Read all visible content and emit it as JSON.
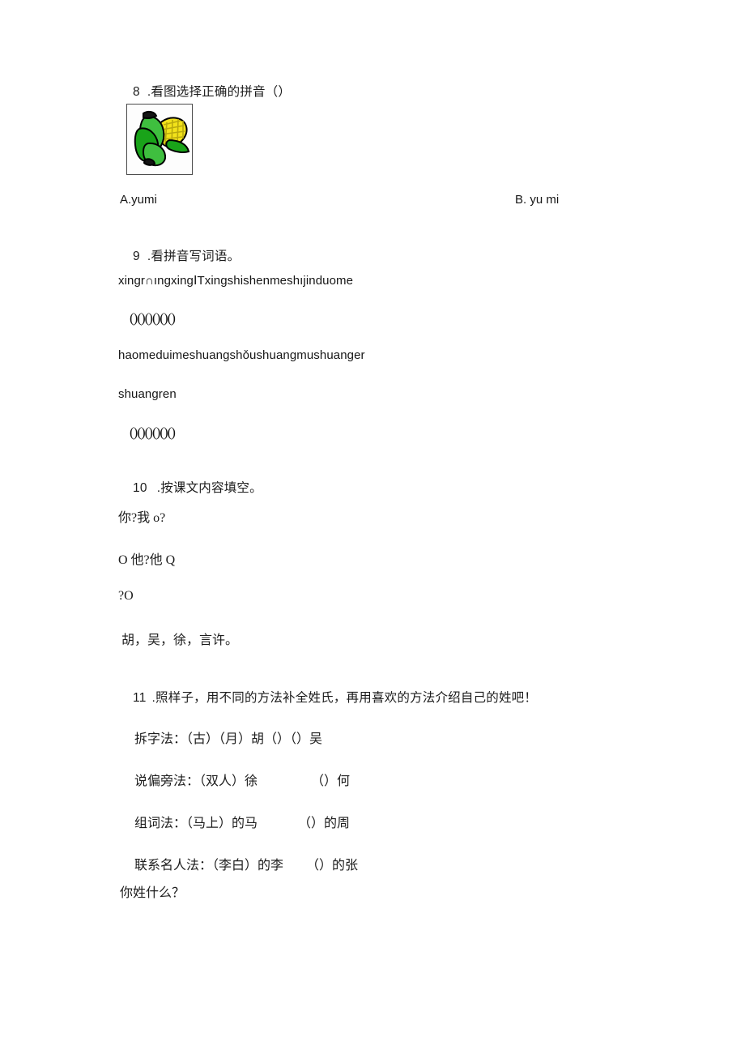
{
  "document": {
    "type": "chinese-primary-worksheet",
    "page_background": "#ffffff",
    "text_color": "#1c1c1c"
  },
  "questions": [
    {
      "id": "q8",
      "number": "8",
      "separator": ".",
      "prompt": "看图选择正确的拼音（）",
      "image": {
        "name": "corn-illustration",
        "alt": "玉米",
        "colors": {
          "husk_light": "#3fbf3f",
          "husk_mid": "#19a319",
          "husk_dark": "#0d7a0d",
          "kernel": "#f2e21a",
          "kernel_shade": "#c9bb12",
          "outline": "#000000",
          "frame": "#4a4a4a"
        }
      },
      "options": [
        {
          "label": "A.yumi"
        },
        {
          "label": "B. yu mi"
        }
      ]
    },
    {
      "id": "q9",
      "number": "9",
      "separator": ".",
      "prompt": "看拼音写词语。",
      "pinyin_lines": [
        "xingr∩ıngxingⅠTxingshishenmeshıjinduome",
        "haomeduimeshuangshǒushuangmushuanger",
        "shuangren"
      ],
      "answer_rows": [
        "()()()()()()",
        "()()()()()()"
      ]
    },
    {
      "id": "q10",
      "number": "10",
      "separator": ".",
      "prompt": "按课文内容填空。",
      "lines": [
        "你?我 o?",
        "O 他?他 Q",
        "?O",
        "胡，吴，徐，言许。"
      ]
    },
    {
      "id": "q11",
      "number": "11",
      "separator": ".",
      "prompt": "照样子，用不同的方法补全姓氏，再用喜欢的方法介绍自己的姓吧！",
      "methods": [
        {
          "name": "拆字法：",
          "example": "（古）（月）胡",
          "blank": "（）（）吴"
        },
        {
          "name": "说偏旁法：",
          "example": "（双人）徐",
          "blank": "（）何"
        },
        {
          "name": "组词法：",
          "example": "（马上）的马",
          "blank": "（）的周"
        },
        {
          "name": "联系名人法：",
          "example": "（李白）的李",
          "blank": "（）的张"
        }
      ],
      "closing_question": "你姓什么？"
    }
  ]
}
